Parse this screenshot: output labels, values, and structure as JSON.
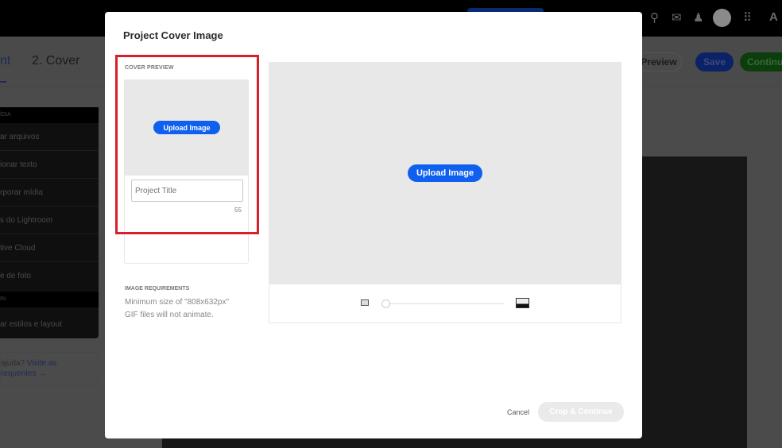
{
  "background": {
    "tabs": [
      "nt",
      "2. Cover"
    ],
    "buttons": {
      "preview": "Preview",
      "save": "Save",
      "continue": "Continue"
    },
    "sidebar": {
      "section1": "ÍDIA",
      "items1": [
        "ar arquivos",
        "ionar texto",
        "rporar mídia",
        "s do Lightroom",
        "tive Cloud",
        "e de foto"
      ],
      "section2": "IN",
      "items2": [
        "ar estilos e layout"
      ]
    },
    "help": {
      "text": "ajuda?",
      "link1": "Visite as",
      "link2": "requentes →"
    }
  },
  "modal": {
    "title": "Project Cover Image",
    "cover_preview_label": "COVER PREVIEW",
    "upload_small": "Upload Image",
    "project_title_placeholder": "Project Title",
    "char_count": "55",
    "requirements_label": "IMAGE REQUIREMENTS",
    "requirements": [
      "Minimum size of \"808x632px\"",
      "GIF files will not animate."
    ],
    "upload_large": "Upload Image",
    "zoom_slider_value": 0,
    "cancel": "Cancel",
    "crop_continue": "Crop & Continue"
  }
}
